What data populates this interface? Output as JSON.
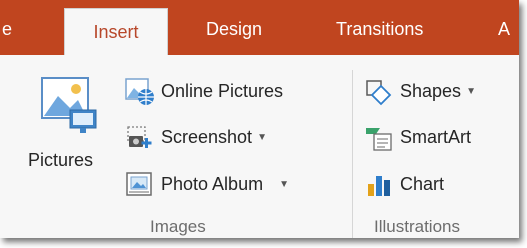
{
  "tabs": {
    "home_partial": "e",
    "insert": "Insert",
    "design": "Design",
    "transitions": "Transitions",
    "animations_partial": "A"
  },
  "images_group": {
    "label": "Images",
    "pictures": "Pictures",
    "online_pictures": "Online Pictures",
    "screenshot": "Screenshot",
    "photo_album": "Photo Album"
  },
  "illustrations_group": {
    "label": "Illustrations",
    "shapes": "Shapes",
    "smartart": "SmartArt",
    "chart": "Chart"
  },
  "colors": {
    "tab_bar": "#c0451f",
    "active_tab_text": "#b7472a",
    "ribbon_bg": "#f7f7f7"
  },
  "icons": [
    "pictures-icon",
    "online-pictures-icon",
    "screenshot-icon",
    "photo-album-icon",
    "shapes-icon",
    "smartart-icon",
    "chart-icon"
  ]
}
